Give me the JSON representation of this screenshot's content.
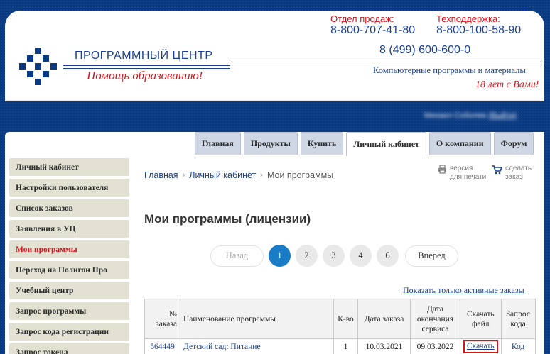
{
  "header": {
    "brand": "ПРОГРАММНЫЙ ЦЕНТР",
    "slogan": "Помощь образованию!",
    "sales_label": "Отдел продаж:",
    "sales_phone": "8-800-707-41-80",
    "support_label": "Техподдержка:",
    "support_phone": "8-800-100-58-90",
    "main_phone": "8 (499) 600-600-0",
    "tagline": "Компьютерные программы и материалы",
    "years": "18 лет с Вами!"
  },
  "user": {
    "name": "Михаил Соболев",
    "logout": "(Выйти)"
  },
  "tabs": [
    {
      "label": "Главная"
    },
    {
      "label": "Продукты"
    },
    {
      "label": "Купить"
    },
    {
      "label": "Личный кабинет"
    },
    {
      "label": "О компании"
    },
    {
      "label": "Форум"
    }
  ],
  "sidebar": {
    "items": [
      {
        "label": "Личный кабинет"
      },
      {
        "label": "Настройки пользователя"
      },
      {
        "label": "Список заказов"
      },
      {
        "label": "Заявления в УЦ"
      },
      {
        "label": "Мои программы"
      },
      {
        "label": "Переход на Полигон Про"
      },
      {
        "label": "Учебный центр"
      },
      {
        "label": "Запрос программы"
      },
      {
        "label": "Запрос кода регистрации"
      },
      {
        "label": "Запрос токена"
      }
    ]
  },
  "breadcrumb": {
    "home": "Главная",
    "cabinet": "Личный кабинет",
    "current": "Мои программы"
  },
  "actions": {
    "print_line1": "версия",
    "print_line2": "для печати",
    "order_line1": "сделать",
    "order_line2": "заказ"
  },
  "page_title": "Мои программы (лицензии)",
  "pagination": {
    "prev": "Назад",
    "pages": [
      "1",
      "2",
      "3",
      "4",
      "6"
    ],
    "next": "Вперед"
  },
  "active_only_link": "Показать только активные заказы",
  "table": {
    "headers": {
      "order_no_1": "№",
      "order_no_2": "заказа",
      "name": "Наименование программы",
      "qty": "К-во",
      "order_date": "Дата заказа",
      "end_1": "Дата",
      "end_2": "окончания",
      "end_3": "сервиса",
      "dl_1": "Скачать",
      "dl_2": "файл",
      "code_1": "Запрос",
      "code_2": "кода"
    },
    "rows": [
      {
        "order": "564449",
        "name": "Детский сад: Питание",
        "qty": "1",
        "order_date": "10.03.2021",
        "end_date": "09.03.2022",
        "download": "Скачать",
        "code": "Код"
      }
    ]
  },
  "colors": {
    "brand_blue": "#0a3a82",
    "accent_red": "#d6141c",
    "page_current": "#1a7bc7"
  }
}
